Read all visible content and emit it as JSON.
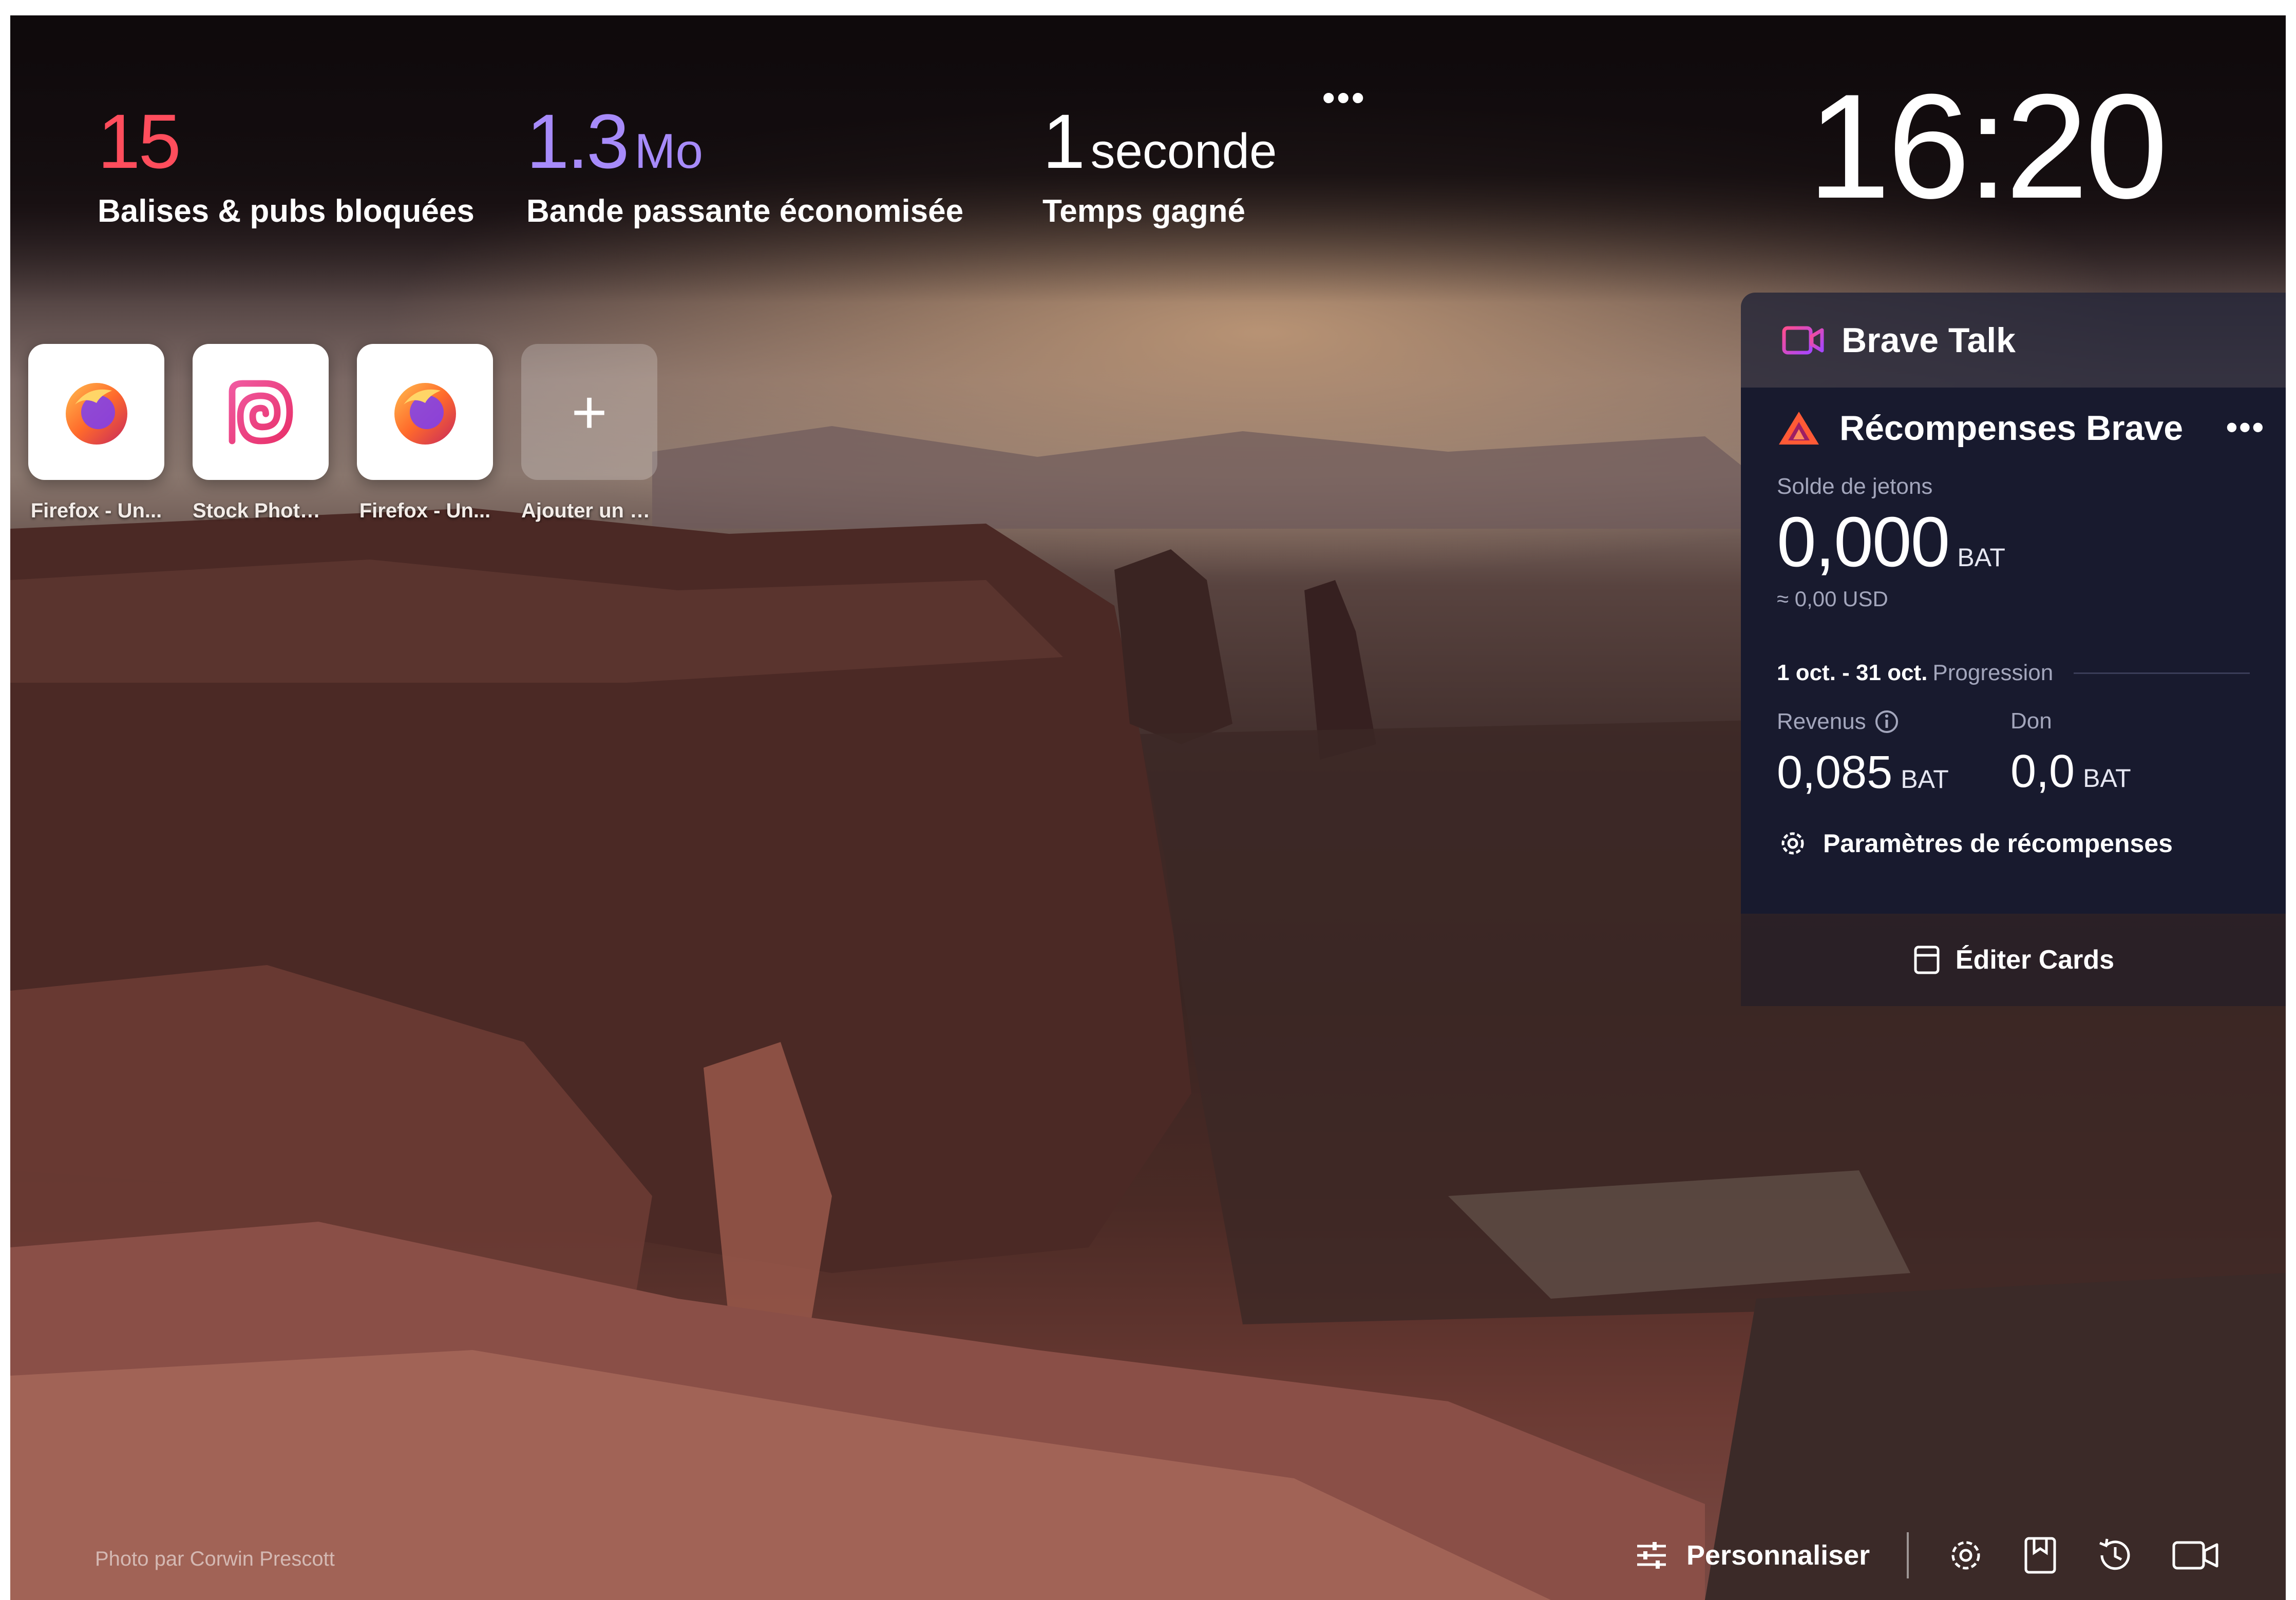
{
  "stats": {
    "trackers": {
      "value": "15",
      "label": "Balises & pubs bloquées"
    },
    "bandwidth": {
      "value": "1.3",
      "unit": "Mo",
      "label": "Bande passante économisée"
    },
    "time": {
      "value": "1",
      "unit": "seconde",
      "label": "Temps gagné"
    },
    "more_label": "•••"
  },
  "clock": "16:20",
  "top_sites": [
    {
      "label": "Firefox - Un...",
      "icon": "firefox-icon"
    },
    {
      "label": "Stock Photo...",
      "icon": "stock-photo-icon"
    },
    {
      "label": "Firefox - Un...",
      "icon": "firefox-icon"
    },
    {
      "label": "Ajouter un si...",
      "icon": "plus-icon"
    }
  ],
  "widgets": {
    "talk": {
      "title": "Brave Talk",
      "icon": "video-camera-icon"
    },
    "rewards": {
      "title": "Récompenses Brave",
      "more_label": "•••",
      "balance_label": "Solde de jetons",
      "balance_value": "0,000",
      "balance_unit": "BAT",
      "balance_usd": "≈ 0,00 USD",
      "period_range": "1 oct. - 31 oct.",
      "period_label": "Progression",
      "earnings_label": "Revenus",
      "earnings_value": "0,085",
      "earnings_unit": "BAT",
      "donation_label": "Don",
      "donation_value": "0,0",
      "donation_unit": "BAT",
      "settings_label": "Paramètres de récompenses"
    },
    "edit_cards_label": "Éditer Cards"
  },
  "photo_credit": "Photo par Corwin Prescott",
  "bottom_bar": {
    "customize_label": "Personnaliser",
    "icons": [
      "sliders-icon",
      "gear-icon",
      "bookmarks-icon",
      "history-icon",
      "video-camera-icon"
    ]
  },
  "colors": {
    "trackers_accent": "#ff4d5c",
    "bandwidth_accent": "#a78bfa",
    "rewards_bg": "#181a2e",
    "brave_orange": "#ff5a36"
  }
}
